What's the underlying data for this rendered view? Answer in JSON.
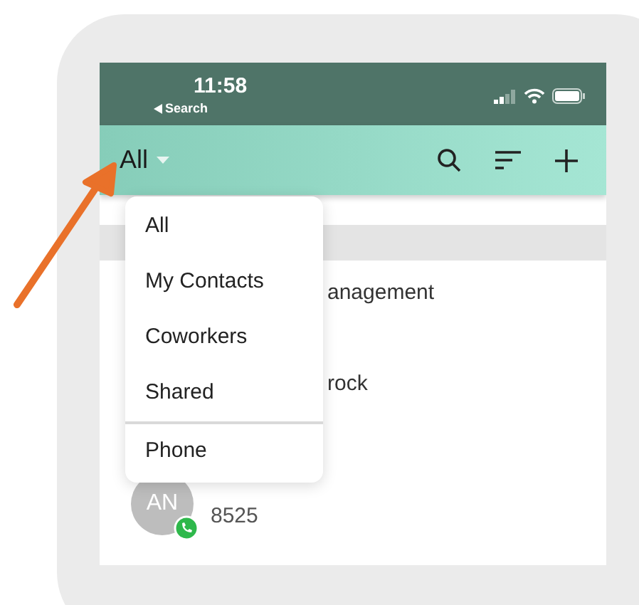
{
  "status_bar": {
    "time": "11:58",
    "back_label": "Search"
  },
  "header": {
    "filter": "All"
  },
  "rows": [
    {
      "kind": "text",
      "text": "anagement"
    },
    {
      "kind": "text",
      "text": "rock"
    },
    {
      "kind": "contact",
      "initials": "AN",
      "number": "8525",
      "phone_badge": true
    }
  ],
  "menu": {
    "items": [
      {
        "label": "All",
        "divider_before": false
      },
      {
        "label": "My Contacts",
        "divider_before": false
      },
      {
        "label": "Coworkers",
        "divider_before": false
      },
      {
        "label": "Shared",
        "divider_before": false
      },
      {
        "label": "Phone",
        "divider_before": true
      }
    ]
  }
}
